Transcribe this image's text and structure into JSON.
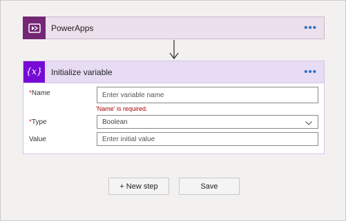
{
  "powerapps_card": {
    "title": "PowerApps",
    "more_label": "•••",
    "icon": "powerapps-icon",
    "color": "#742774"
  },
  "init_card": {
    "title": "Initialize variable",
    "more_label": "•••",
    "icon_text": "{x}",
    "color": "#770bd6",
    "fields": {
      "name_required": "*",
      "name_label": "Name",
      "name_placeholder": "Enter variable name",
      "name_error": "'Name' is required.",
      "type_required": "*",
      "type_label": "Type",
      "type_value": "Boolean",
      "value_label": "Value",
      "value_placeholder": "Enter initial value"
    }
  },
  "actions": {
    "new_step_label": "+ New step",
    "save_label": "Save"
  }
}
